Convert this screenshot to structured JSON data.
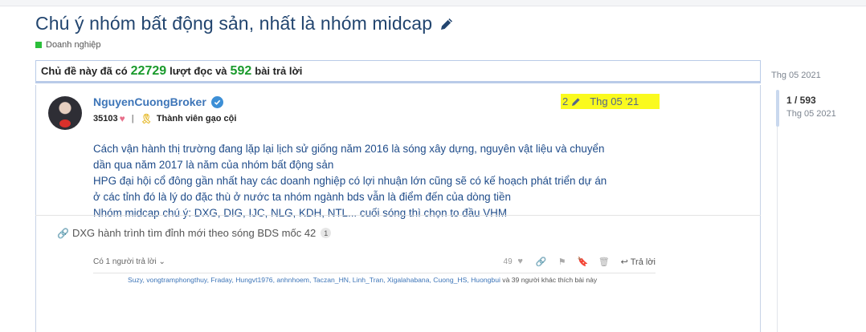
{
  "topic": {
    "title": "Chú ý nhóm bất động sản, nhất là nhóm midcap",
    "category": "Doanh nghiệp",
    "category_color": "#2bbf3a"
  },
  "summary": {
    "prefix": "Chủ đề này đã có",
    "views": "22729",
    "middle": "lượt đọc và",
    "replies": "592",
    "suffix": "bài trả lời"
  },
  "post": {
    "username": "NguyenCuongBroker",
    "score": "35103",
    "badge": "Thành viên gạo cội",
    "edit_count": "2",
    "date": "Thg 05 '21",
    "lines": [
      "Cách vận hành thị trường đang lặp lại lịch sử giống năm 2016 là sóng xây dựng, nguyên vật liệu và chuyển",
      "dần qua năm 2017 là năm của nhóm bất động sản",
      "HPG đại hội cổ đông gần nhất hay các doanh nghiệp có lợi nhuận lớn cũng sẽ có kế hoạch phát triển dự án",
      "ở các tỉnh đó là lý do đặc thù ở nước ta nhóm ngành bds vẫn là điểm đến của dòng tiền",
      "Nhóm midcap chú ý: DXG, DIG, IJC, NLG, KDH, NTL... cuối sóng thì chọn to đầu VHM"
    ],
    "replies_toggle": "Có 1 người trả lời",
    "like_count": "49",
    "reply_label": "Trả lời",
    "likes_names": "Suzy, vongtramphongthuy, Fraday, Hungvt1976, anhnhoem, Taczan_HN, Linh_Tran, Xigalahabana, Cuong_HS, Huongbui",
    "likes_suffix": "và 39 người khác thích bài này"
  },
  "linked_topic": {
    "title": "DXG hành trình tìm đỉnh mới theo sóng BDS mốc 42",
    "count": "1"
  },
  "timeline": {
    "top_date": "Thg 05 2021",
    "position": "1 / 593",
    "current_date": "Thg 05 2021"
  },
  "colors": {
    "title": "#22456f",
    "link": "#3d75b8",
    "content": "#1f4c8a",
    "highlight": "#fafa1e",
    "count_green": "#1a9a2c"
  }
}
